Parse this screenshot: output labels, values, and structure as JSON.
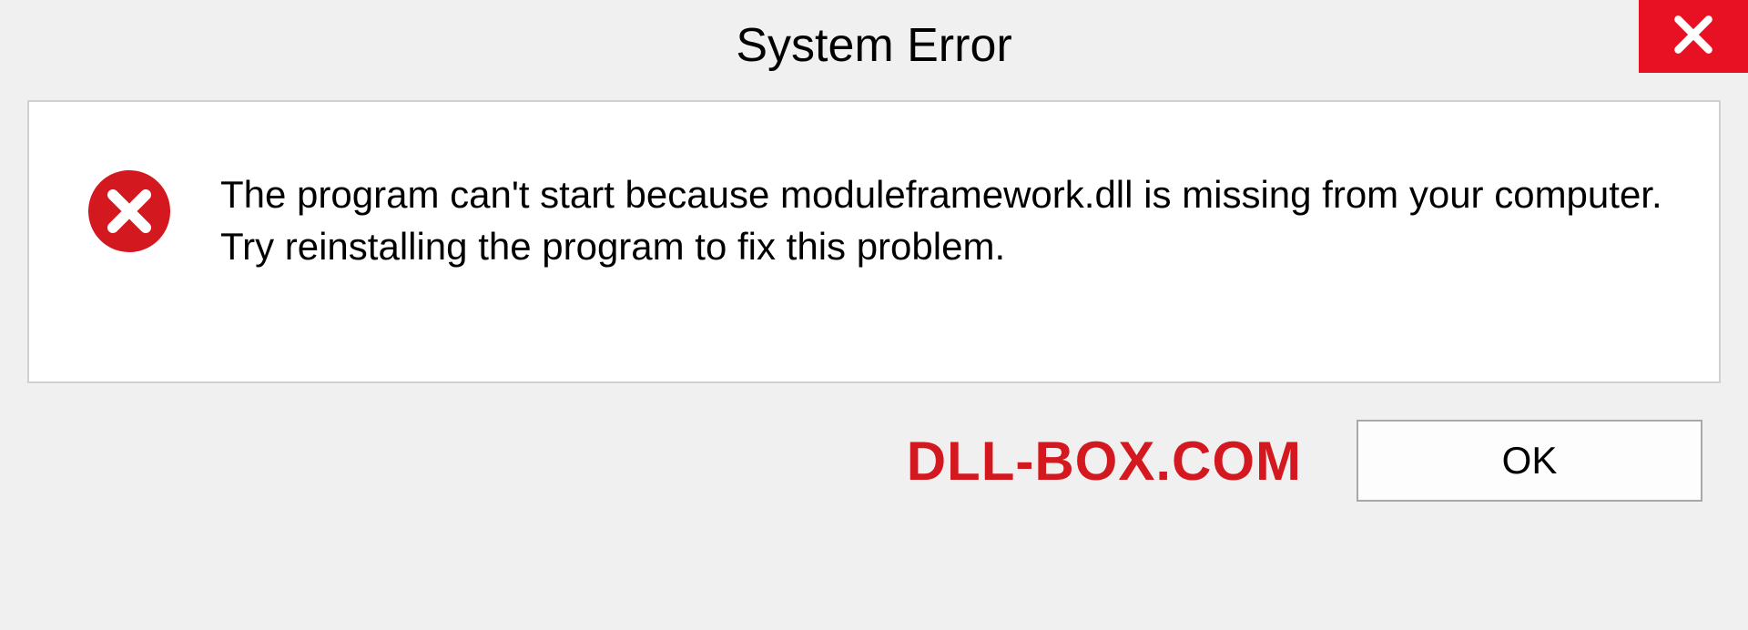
{
  "titlebar": {
    "title": "System Error"
  },
  "body": {
    "message": "The program can't start because moduleframework.dll is missing from your computer. Try reinstalling the program to fix this problem."
  },
  "footer": {
    "watermark": "DLL-BOX.COM",
    "ok_label": "OK"
  },
  "colors": {
    "close_bg": "#e81123",
    "error_icon": "#d4181f",
    "watermark": "#d4181f"
  }
}
